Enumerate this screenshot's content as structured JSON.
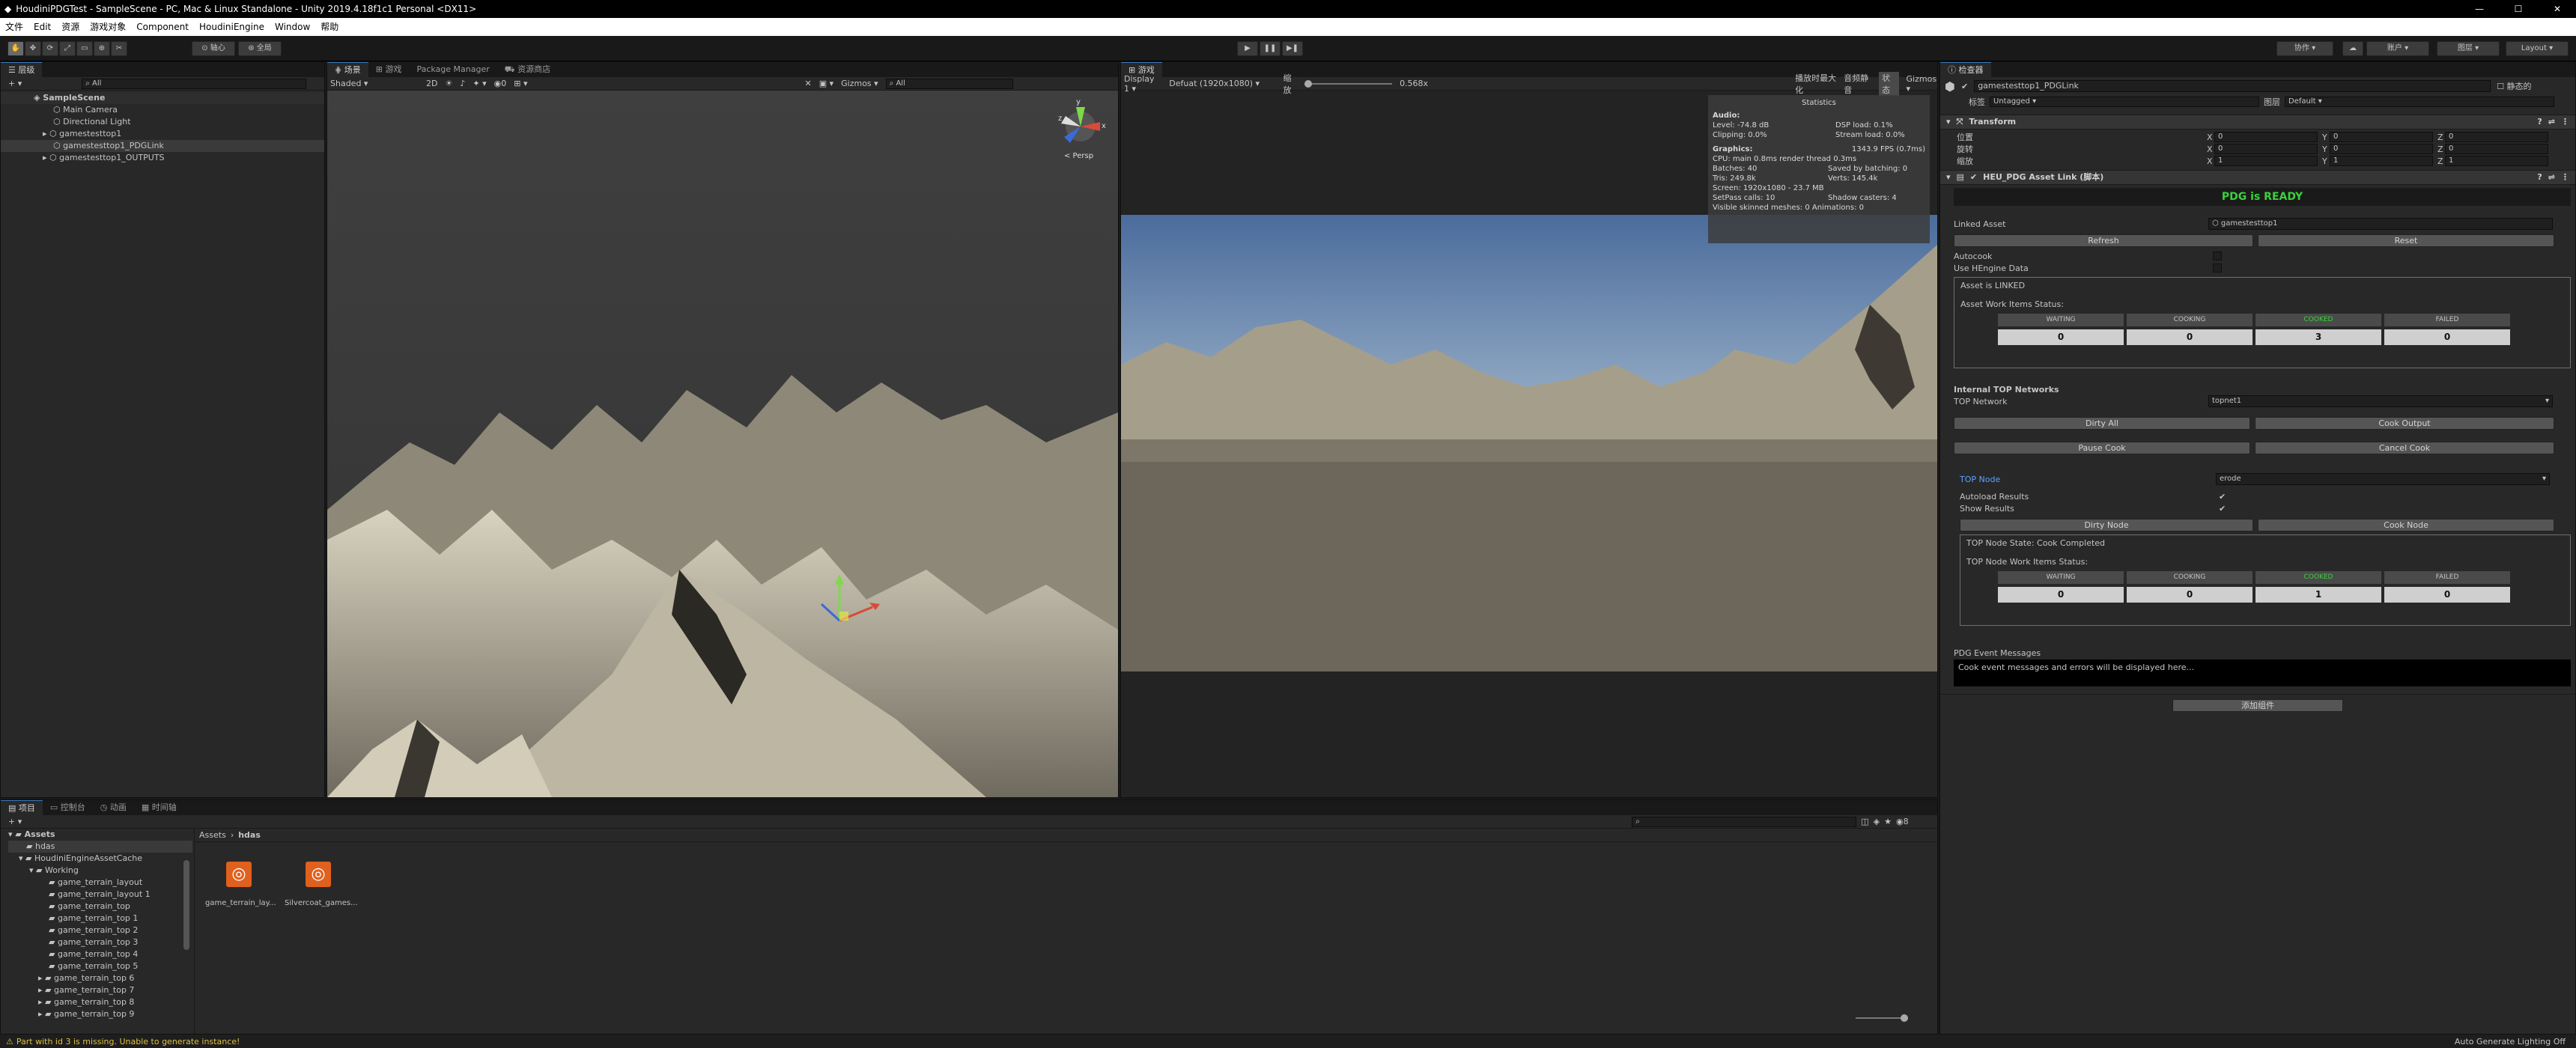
{
  "window": {
    "title": "HoudiniPDGTest - SampleScene - PC, Mac & Linux Standalone - Unity 2019.4.18f1c1 Personal <DX11>"
  },
  "menu": [
    "文件",
    "Edit",
    "资源",
    "游戏对象",
    "Component",
    "HoudiniEngine",
    "Window",
    "帮助"
  ],
  "toolbar": {
    "pivot": "轴心",
    "global": "全局",
    "collab": "协作",
    "account": "账户",
    "layers": "图层",
    "layout": "Layout"
  },
  "hierarchy": {
    "tab": "层级",
    "search_placeholder": "All",
    "scene": "SampleScene",
    "items": [
      "Main Camera",
      "Directional Light",
      "gamestesttop1",
      "gamestesttop1_PDGLink",
      "gamestesttop1_OUTPUTS"
    ]
  },
  "scene_view": {
    "tabs": [
      "场景",
      "游戏",
      "Package Manager",
      "资源商店"
    ],
    "shading": "Shaded",
    "mode_2d": "2D",
    "gizmos": "Gizmos",
    "search": "All",
    "persp": "< Persp",
    "count": "0"
  },
  "game_view": {
    "tab": "游戏",
    "display": "Display 1",
    "resolution": "Defuat (1920x1080)",
    "scale_label": "缩放",
    "scale_value": "0.568x",
    "maximize": "播放时最大化",
    "mute": "音频静音",
    "stats": "状态",
    "gizmos": "Gizmos"
  },
  "statistics": {
    "title": "Statistics",
    "audio_label": "Audio:",
    "level": "Level: -74.8 dB",
    "clipping": "Clipping: 0.0%",
    "dsp": "DSP load: 0.1%",
    "stream": "Stream load: 0.0%",
    "graphics_label": "Graphics:",
    "fps": "1343.9 FPS (0.7ms)",
    "cpu": "CPU: main 0.8ms  render thread 0.3ms",
    "batches": "Batches: 40",
    "saved": "Saved by batching: 0",
    "tris": "Tris: 249.8k",
    "verts": "Verts: 145.4k",
    "screen": "Screen: 1920x1080 - 23.7 MB",
    "setpass": "SetPass calls: 10",
    "shadow": "Shadow casters: 4",
    "skinned": "Visible skinned meshes: 0  Animations: 0"
  },
  "inspector": {
    "tab": "检查器",
    "object_name": "gamestesttop1_PDGLink",
    "static": "静态的",
    "tag_label": "标签",
    "tag_value": "Untagged",
    "layer_label": "图层",
    "layer_value": "Default",
    "transform": {
      "title": "Transform",
      "rows": [
        {
          "label": "位置",
          "x": "0",
          "y": "0",
          "z": "0"
        },
        {
          "label": "旋转",
          "x": "0",
          "y": "0",
          "z": "0"
        },
        {
          "label": "缩放",
          "x": "1",
          "y": "1",
          "z": "1"
        }
      ],
      "axis": [
        "X",
        "Y",
        "Z"
      ]
    },
    "pdg": {
      "title": "HEU_PDG Asset Link   (脚本)",
      "ready": "PDG is READY",
      "linked_asset_label": "Linked Asset",
      "linked_asset_value": "gamestesttop1",
      "refresh": "Refresh",
      "reset": "Reset",
      "autocook": "Autocook",
      "use_hengine": "Use HEngine Data",
      "asset_linked": "Asset is LINKED",
      "asset_work_items": "Asset Work Items Status:",
      "status_headers": [
        "WAITING",
        "COOKING",
        "COOKED",
        "FAILED"
      ],
      "asset_counts": [
        "0",
        "0",
        "3",
        "0"
      ],
      "internal_top": "Internal TOP Networks",
      "top_network_label": "TOP Network",
      "top_network_value": "topnet1",
      "dirty_all": "Dirty All",
      "cook_output": "Cook Output",
      "pause_cook": "Pause Cook",
      "cancel_cook": "Cancel Cook",
      "top_node_label": "TOP Node",
      "top_node_value": "erode",
      "autoload": "Autoload Results",
      "show_results": "Show Results",
      "dirty_node": "Dirty Node",
      "cook_node": "Cook Node",
      "node_state": "TOP Node State: Cook Completed",
      "node_work_items": "TOP Node Work Items Status:",
      "node_counts": [
        "0",
        "0",
        "1",
        "0"
      ],
      "event_label": "PDG Event Messages",
      "event_text": "Cook event messages and errors will be displayed here..."
    },
    "add_component": "添加组件",
    "cooked_color": "#3ad23a"
  },
  "project": {
    "tabs": [
      "项目",
      "控制台",
      "动画",
      "时间轴"
    ],
    "tree": [
      "Assets",
      "hdas",
      "HoudiniEngineAssetCache",
      "Working",
      "game_terrain_layout",
      "game_terrain_layout 1",
      "game_terrain_top",
      "game_terrain_top 1",
      "game_terrain_top 2",
      "game_terrain_top 3",
      "game_terrain_top 4",
      "game_terrain_top 5",
      "game_terrain_top 6",
      "game_terrain_top 7",
      "game_terrain_top 8",
      "game_terrain_top 9"
    ],
    "breadcrumb": [
      "Assets",
      "hdas"
    ],
    "assets": [
      "game_terrain_lay...",
      "Silvercoat_games..."
    ],
    "count": "8"
  },
  "status": {
    "message": "Part with id 3 is missing. Unable to generate instance!",
    "lighting": "Auto Generate Lighting Off"
  }
}
